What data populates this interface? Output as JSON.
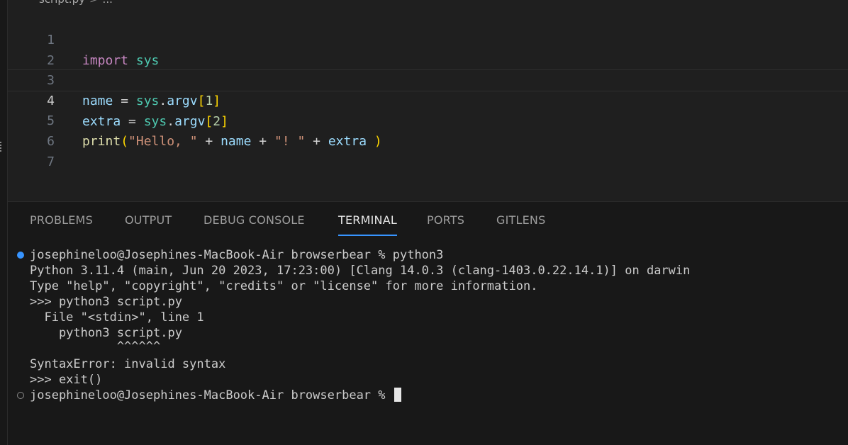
{
  "breadcrumb": {
    "file": "script.py",
    "separator": ">",
    "more": "..."
  },
  "editor": {
    "current_line": "4",
    "lines": [
      {
        "n": "1",
        "t1": "import",
        "t2": " ",
        "t3": "sys"
      },
      {
        "n": "2"
      },
      {
        "n": "3",
        "t1": "name",
        "t2": " = ",
        "t3": "sys",
        "t4": ".",
        "t5": "argv",
        "t6": "[",
        "t7": "1",
        "t8": "]"
      },
      {
        "n": "4",
        "t1": "extra",
        "t2": " = ",
        "t3": "sys",
        "t4": ".",
        "t5": "argv",
        "t6": "[",
        "t7": "2",
        "t8": "]"
      },
      {
        "n": "5",
        "t1": "print",
        "t2": "(",
        "t3": "\"Hello, \"",
        "t4": " + ",
        "t5": "name",
        "t6": " + ",
        "t7": "\"! \"",
        "t8": " + ",
        "t9": "extra",
        "t10": " ",
        "t11": ")"
      },
      {
        "n": "6"
      },
      {
        "n": "7"
      }
    ]
  },
  "panel": {
    "tabs": [
      "PROBLEMS",
      "OUTPUT",
      "DEBUG CONSOLE",
      "TERMINAL",
      "PORTS",
      "GITLENS"
    ],
    "active_tab": "TERMINAL"
  },
  "terminal": {
    "lines": [
      "josephineloo@Josephines-MacBook-Air browserbear % python3",
      "Python 3.11.4 (main, Jun 20 2023, 17:23:00) [Clang 14.0.3 (clang-1403.0.22.14.1)] on darwin",
      "Type \"help\", \"copyright\", \"credits\" or \"license\" for more information.",
      ">>> python3 script.py",
      "  File \"<stdin>\", line 1",
      "    python3 script.py",
      "            ^^^^^^",
      "SyntaxError: invalid syntax",
      ">>> exit()",
      "josephineloo@Josephines-MacBook-Air browserbear % "
    ]
  },
  "colors": {
    "accent": "#3794ff",
    "background": "#1f1f1f",
    "panel": "#181818"
  }
}
